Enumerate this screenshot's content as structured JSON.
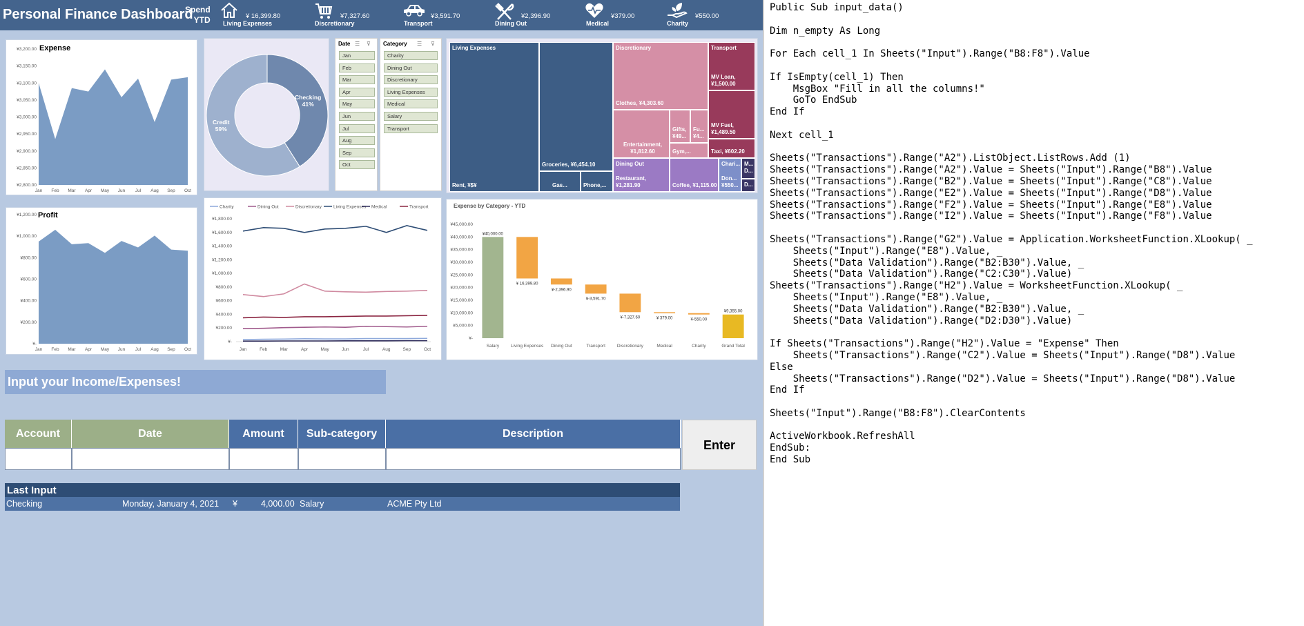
{
  "header": {
    "title": "Personal Finance Dashboard",
    "spend_label_1": "Spend",
    "spend_label_2": "YTD",
    "kpis": [
      {
        "icon": "home-icon",
        "amount": "¥ 16,399.80",
        "label": "Living Expenses"
      },
      {
        "icon": "shopping-cart-icon",
        "amount": "¥7,327.60",
        "label": "Discretionary"
      },
      {
        "icon": "car-icon",
        "amount": "¥3,591.70",
        "label": "Transport"
      },
      {
        "icon": "fork-knife-icon",
        "amount": "¥2,396.90",
        "label": "Dining Out"
      },
      {
        "icon": "heart-pulse-icon",
        "amount": "¥379.00",
        "label": "Medical"
      },
      {
        "icon": "hand-leaf-icon",
        "amount": "¥550.00",
        "label": "Charity"
      }
    ]
  },
  "expense_chart": {
    "title": "Expense",
    "yticks": [
      "¥3,200.00",
      "¥3,150.00",
      "¥3,100.00",
      "¥3,050.00",
      "¥3,000.00",
      "¥2,950.00",
      "¥2,900.00",
      "¥2,850.00",
      "¥2,800.00"
    ],
    "months": [
      "Jan",
      "Feb",
      "Mar",
      "Apr",
      "May",
      "Jun",
      "Jul",
      "Aug",
      "Sep",
      "Oct"
    ]
  },
  "profit_chart": {
    "title": "Profit",
    "yticks": [
      "¥1,200.00",
      "¥1,000.00",
      "¥800.00",
      "¥600.00",
      "¥400.00",
      "¥200.00",
      "¥-"
    ],
    "months": [
      "Jan",
      "Feb",
      "Mar",
      "Apr",
      "May",
      "Jun",
      "Jul",
      "Aug",
      "Sep",
      "Oct"
    ]
  },
  "donut": {
    "checking_label": "Checking",
    "checking_pct": "41%",
    "credit_label": "Credit",
    "credit_pct": "59%"
  },
  "slicers": {
    "date_header": "Date",
    "date_items": [
      "Jan",
      "Feb",
      "Mar",
      "Apr",
      "May",
      "Jun",
      "Jul",
      "Aug",
      "Sep",
      "Oct"
    ],
    "category_header": "Category",
    "category_items": [
      "Charity",
      "Dining Out",
      "Discretionary",
      "Living Expenses",
      "Medical",
      "Salary",
      "Transport"
    ]
  },
  "treemap": {
    "living_expenses": "Living Expenses",
    "rent": "Rent,  ¥$¥",
    "groceries": "Groceries,  ¥6,454.10",
    "gas": "Gas...",
    "phone": "Phone,...",
    "discretionary": "Discretionary",
    "clothes": "Clothes,  ¥4,303.60",
    "entertainment": "Entertainment,  ¥1,812.60",
    "gifts": "Gifts, ¥49...",
    "fu": "Fu... ¥4...",
    "gym": "Gym,...",
    "transport": "Transport",
    "mv_loan": "MV Loan, ¥1,500.00",
    "mv_fuel": "MV Fuel, ¥1,489.50",
    "taxi": "Taxi,  ¥602.20",
    "dining_out": "Dining Out",
    "restaurant": "Restaurant, ¥1,281.90",
    "coffee": "Coffee, ¥1,115.00",
    "chari": "Chari...",
    "don": "Don... ¥550...",
    "m": "M... D...",
    "d": "D..."
  },
  "line_chart": {
    "legend": [
      "Charity",
      "Dining Out",
      "Discretionary",
      "Living Expenses",
      "Medical",
      "Transport"
    ],
    "colors": [
      "#8ea9db",
      "#a05a8c",
      "#d08aa0",
      "#2e4d75",
      "#2f2d5c",
      "#8b2541"
    ],
    "yticks": [
      "¥1,800.00",
      "¥1,600.00",
      "¥1,400.00",
      "¥1,200.00",
      "¥1,000.00",
      "¥800.00",
      "¥600.00",
      "¥400.00",
      "¥200.00",
      "¥-"
    ],
    "months": [
      "Jan",
      "Feb",
      "Mar",
      "Apr",
      "May",
      "Jun",
      "Jul",
      "Aug",
      "Sep",
      "Oct"
    ]
  },
  "waterfall": {
    "title": "Expense by Category - YTD",
    "yticks": [
      "¥45,000.00",
      "¥40,000.00",
      "¥35,000.00",
      "¥30,000.00",
      "¥25,000.00",
      "¥20,000.00",
      "¥15,000.00",
      "¥10,000.00",
      "¥5,000.00",
      "¥-"
    ],
    "data_labels": [
      "¥40,000.00",
      "¥ 16,399.80",
      "¥-2,396.90",
      "¥-3,591.70",
      "¥-7,327.60",
      "¥ 379.00",
      "¥-550.00",
      "¥9,355.00"
    ],
    "categories": [
      "Salary",
      "Living Expenses",
      "Dining Out",
      "Transport",
      "Discretionary",
      "Medical",
      "Charity",
      "Grand Total"
    ]
  },
  "chart_data": [
    {
      "type": "area",
      "title": "Expense",
      "categories": [
        "Jan",
        "Feb",
        "Mar",
        "Apr",
        "May",
        "Jun",
        "Jul",
        "Aug",
        "Sep",
        "Oct"
      ],
      "values": [
        3100,
        2935,
        3085,
        3075,
        3140,
        3058,
        3113,
        2985,
        3110,
        3117
      ],
      "ylim": [
        2800,
        3200
      ]
    },
    {
      "type": "area",
      "title": "Profit",
      "categories": [
        "Jan",
        "Feb",
        "Mar",
        "Apr",
        "May",
        "Jun",
        "Jul",
        "Aug",
        "Sep",
        "Oct"
      ],
      "values": [
        950,
        1060,
        925,
        935,
        845,
        955,
        895,
        1005,
        875,
        865
      ],
      "ylim": [
        0,
        1200
      ]
    },
    {
      "type": "pie",
      "categories": [
        "Checking",
        "Credit"
      ],
      "values": [
        41,
        59
      ]
    },
    {
      "type": "line",
      "categories": [
        "Jan",
        "Feb",
        "Mar",
        "Apr",
        "May",
        "Jun",
        "Jul",
        "Aug",
        "Sep",
        "Oct"
      ],
      "ylim": [
        0,
        1800
      ],
      "series": [
        {
          "name": "Charity",
          "values": [
            30,
            35,
            38,
            42,
            40,
            40,
            45,
            45,
            45,
            48
          ]
        },
        {
          "name": "Dining Out",
          "values": [
            190,
            195,
            205,
            210,
            215,
            210,
            225,
            220,
            215,
            225
          ]
        },
        {
          "name": "Discretionary",
          "values": [
            690,
            660,
            700,
            845,
            740,
            730,
            725,
            735,
            740,
            750
          ]
        },
        {
          "name": "Living Expenses",
          "values": [
            1620,
            1670,
            1660,
            1600,
            1650,
            1660,
            1690,
            1600,
            1700,
            1630
          ]
        },
        {
          "name": "Medical",
          "values": [
            8,
            8,
            10,
            10,
            10,
            12,
            12,
            12,
            14,
            14
          ]
        },
        {
          "name": "Transport",
          "values": [
            350,
            360,
            355,
            365,
            365,
            370,
            375,
            375,
            380,
            385
          ]
        }
      ]
    },
    {
      "type": "bar",
      "title": "Expense by Category - YTD",
      "categories": [
        "Salary",
        "Living Expenses",
        "Dining Out",
        "Transport",
        "Discretionary",
        "Medical",
        "Charity",
        "Grand Total"
      ],
      "values": [
        40000,
        -16399.8,
        -2396.9,
        -3591.7,
        -7327.6,
        -379,
        -550,
        9355
      ],
      "ylim": [
        0,
        45000
      ]
    }
  ],
  "input_form": {
    "title": "Input your Income/Expenses!",
    "headers": [
      "Account",
      "Date",
      "Amount",
      "Sub-category",
      "Description"
    ],
    "enter_label": "Enter"
  },
  "last_input": {
    "title": "Last Input",
    "account": "Checking",
    "date": "Monday, January 4, 2021",
    "currency": "¥",
    "amount": "4,000.00",
    "subcategory": "Salary",
    "description": "ACME Pty Ltd"
  },
  "code_lines": [
    "Public Sub input_data()",
    "",
    "Dim n_empty As Long",
    "",
    "For Each cell_1 In Sheets(\"Input\").Range(\"B8:F8\").Value",
    "",
    "If IsEmpty(cell_1) Then",
    "    MsgBox \"Fill in all the columns!\"",
    "    GoTo EndSub",
    "End If",
    "",
    "Next cell_1",
    "",
    "Sheets(\"Transactions\").Range(\"A2\").ListObject.ListRows.Add (1)",
    "Sheets(\"Transactions\").Range(\"A2\").Value = Sheets(\"Input\").Range(\"B8\").Value",
    "Sheets(\"Transactions\").Range(\"B2\").Value = Sheets(\"Input\").Range(\"C8\").Value",
    "Sheets(\"Transactions\").Range(\"E2\").Value = Sheets(\"Input\").Range(\"D8\").Value",
    "Sheets(\"Transactions\").Range(\"F2\").Value = Sheets(\"Input\").Range(\"E8\").Value",
    "Sheets(\"Transactions\").Range(\"I2\").Value = Sheets(\"Input\").Range(\"F8\").Value",
    "",
    "Sheets(\"Transactions\").Range(\"G2\").Value = Application.WorksheetFunction.XLookup( _",
    "    Sheets(\"Input\").Range(\"E8\").Value, _",
    "    Sheets(\"Data Validation\").Range(\"B2:B30\").Value, _",
    "    Sheets(\"Data Validation\").Range(\"C2:C30\").Value)",
    "Sheets(\"Transactions\").Range(\"H2\").Value = WorksheetFunction.XLookup( _",
    "    Sheets(\"Input\").Range(\"E8\").Value, _",
    "    Sheets(\"Data Validation\").Range(\"B2:B30\").Value, _",
    "    Sheets(\"Data Validation\").Range(\"D2:D30\").Value)",
    "",
    "If Sheets(\"Transactions\").Range(\"H2\").Value = \"Expense\" Then",
    "    Sheets(\"Transactions\").Range(\"C2\").Value = Sheets(\"Input\").Range(\"D8\").Value",
    "Else",
    "    Sheets(\"Transactions\").Range(\"D2\").Value = Sheets(\"Input\").Range(\"D8\").Value",
    "End If",
    "",
    "Sheets(\"Input\").Range(\"B8:F8\").ClearContents",
    "",
    "ActiveWorkbook.RefreshAll",
    "EndSub:",
    "End Sub"
  ]
}
